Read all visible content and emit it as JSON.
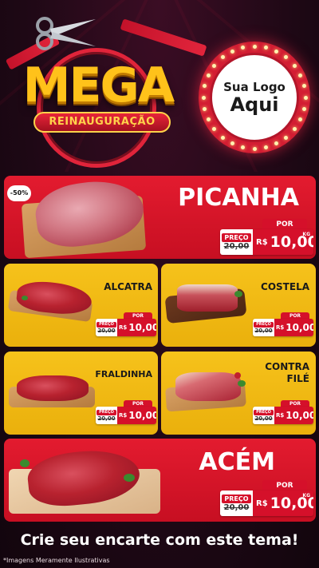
{
  "header": {
    "title": "MEGA",
    "subtitle": "REINAUGURAÇÃO",
    "logo_line1": "Sua Logo",
    "logo_line2": "Aqui"
  },
  "discount_badge": "-50%",
  "price_labels": {
    "por": "POR",
    "preco": "PREÇO",
    "currency": "R$",
    "unit": "KG"
  },
  "products": [
    {
      "name": "PICANHA",
      "old_price": "20,00",
      "new_price": "10,00"
    },
    {
      "name": "ALCATRA",
      "old_price": "20,00",
      "new_price": "10,00"
    },
    {
      "name": "COSTELA",
      "old_price": "20,00",
      "new_price": "10,00"
    },
    {
      "name": "FRALDINHA",
      "old_price": "20,00",
      "new_price": "10,00"
    },
    {
      "name_line1": "CONTRA",
      "name_line2": "FILÉ",
      "old_price": "20,00",
      "new_price": "10,00"
    },
    {
      "name": "ACÉM",
      "old_price": "20,00",
      "new_price": "10,00"
    }
  ],
  "footer": {
    "cta": "Crie seu encarte com este tema!",
    "disclaimer": "*Imagens Meramente Ilustrativas"
  },
  "colors": {
    "brand_red": "#d5102a",
    "brand_yellow": "#f6c21b",
    "background": "#1e0815"
  },
  "icons": [
    "scissors-icon"
  ]
}
